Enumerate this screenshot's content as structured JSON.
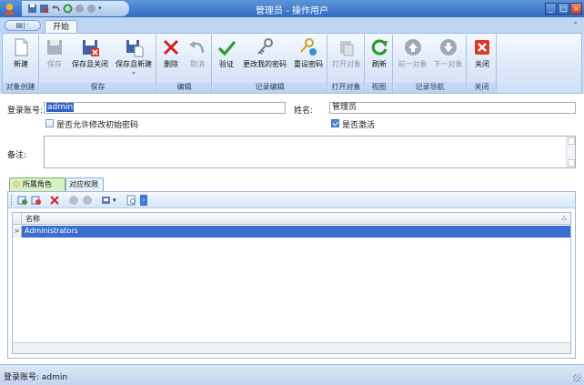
{
  "window": {
    "title": "管理员 - 操作用户"
  },
  "ribbon": {
    "active_tab": "开始",
    "groups": [
      {
        "label": "对象创建",
        "buttons": [
          {
            "label": "新建",
            "enabled": true
          }
        ]
      },
      {
        "label": "保存",
        "buttons": [
          {
            "label": "保存",
            "enabled": false
          },
          {
            "label": "保存且关闭",
            "enabled": true
          },
          {
            "label": "保存且新建",
            "enabled": true
          }
        ]
      },
      {
        "label": "编辑",
        "buttons": [
          {
            "label": "删除",
            "enabled": true
          },
          {
            "label": "取消",
            "enabled": false
          }
        ]
      },
      {
        "label": "记录编辑",
        "buttons": [
          {
            "label": "验证",
            "enabled": true
          },
          {
            "label": "更改我的密码",
            "enabled": true
          },
          {
            "label": "重设密码",
            "enabled": true
          }
        ]
      },
      {
        "label": "打开对象",
        "buttons": [
          {
            "label": "打开对象",
            "enabled": false
          }
        ]
      },
      {
        "label": "视图",
        "buttons": [
          {
            "label": "刷新",
            "enabled": true
          }
        ]
      },
      {
        "label": "记录导航",
        "buttons": [
          {
            "label": "前一对象",
            "enabled": false
          },
          {
            "label": "下一对象",
            "enabled": false
          }
        ]
      },
      {
        "label": "关闭",
        "buttons": [
          {
            "label": "关闭",
            "enabled": true
          }
        ]
      }
    ]
  },
  "form": {
    "login_label": "登录账号:",
    "login_value": "admin",
    "name_label": "姓名:",
    "name_value": "管理员",
    "allow_change_pwd_label": "是否允许修改初始密码",
    "allow_change_pwd_checked": false,
    "active_label": "是否激活",
    "active_checked": true,
    "notes_label": "备注:",
    "notes_value": ""
  },
  "subtabs": [
    {
      "label": "所属角色",
      "active": true
    },
    {
      "label": "对应权限",
      "active": false
    }
  ],
  "grid": {
    "columns": [
      "名称"
    ],
    "rows": [
      {
        "name": "Administrators",
        "selected": true
      }
    ]
  },
  "status": {
    "text": "登录账号: admin"
  },
  "colors": {
    "titlebar": "#3c78cc",
    "selection": "#3a6ed0",
    "active_subtab": "#d7f2c4"
  }
}
